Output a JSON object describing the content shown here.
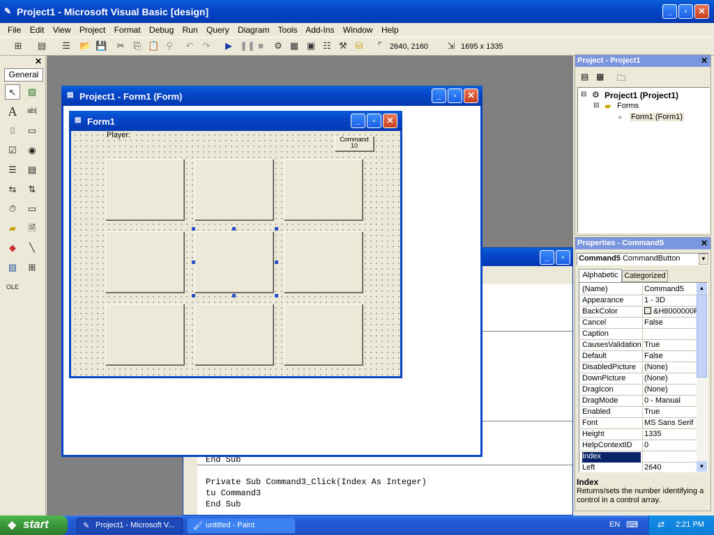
{
  "app": {
    "title": "Project1 - Microsoft Visual Basic [design]"
  },
  "menu": [
    "File",
    "Edit",
    "View",
    "Project",
    "Format",
    "Debug",
    "Run",
    "Query",
    "Diagram",
    "Tools",
    "Add-Ins",
    "Window",
    "Help"
  ],
  "toolbar": {
    "position": "2640, 2160",
    "size": "1695 x 1335"
  },
  "toolbox": {
    "tab": "General"
  },
  "form_window": {
    "title": "Project1 - Form1 (Form)"
  },
  "form": {
    "title": "Form1",
    "player_label": "Player:",
    "command10": "Command 10"
  },
  "code": {
    "lines": [
      "End Sub",
      "",
      "Private Sub Command3_Click(Index As Integer)",
      "tu Command3",
      "End Sub"
    ]
  },
  "project_explorer": {
    "title": "Project - Project1",
    "root": "Project1 (Project1)",
    "folder": "Forms",
    "item": "Form1 (Form1)"
  },
  "properties": {
    "title": "Properties - Command5",
    "object": "Command5",
    "object_type": "CommandButton",
    "tabs": [
      "Alphabetic",
      "Categorized"
    ],
    "rows": [
      {
        "name": "(Name)",
        "value": "Command5"
      },
      {
        "name": "Appearance",
        "value": "1 - 3D"
      },
      {
        "name": "BackColor",
        "value": "&H8000000F"
      },
      {
        "name": "Cancel",
        "value": "False"
      },
      {
        "name": "Caption",
        "value": ""
      },
      {
        "name": "CausesValidation",
        "value": "True"
      },
      {
        "name": "Default",
        "value": "False"
      },
      {
        "name": "DisabledPicture",
        "value": "(None)"
      },
      {
        "name": "DownPicture",
        "value": "(None)"
      },
      {
        "name": "DragIcon",
        "value": "(None)"
      },
      {
        "name": "DragMode",
        "value": "0 - Manual"
      },
      {
        "name": "Enabled",
        "value": "True"
      },
      {
        "name": "Font",
        "value": "MS Sans Serif"
      },
      {
        "name": "Height",
        "value": "1335"
      },
      {
        "name": "HelpContextID",
        "value": "0"
      },
      {
        "name": "Index",
        "value": ""
      },
      {
        "name": "Left",
        "value": "2640"
      }
    ],
    "desc_title": "Index",
    "desc_text": "Returns/sets the number identifying a control in a control array."
  },
  "taskbar": {
    "start": "start",
    "items": [
      "Project1 - Microsoft V...",
      "untitled - Paint"
    ],
    "lang": "EN",
    "clock": "2:21 PM"
  },
  "colors": {
    "titlebar": "#0a5fd8",
    "taskbar": "#245edb",
    "start": "#3c9a3c",
    "selected": "#0a246a"
  }
}
